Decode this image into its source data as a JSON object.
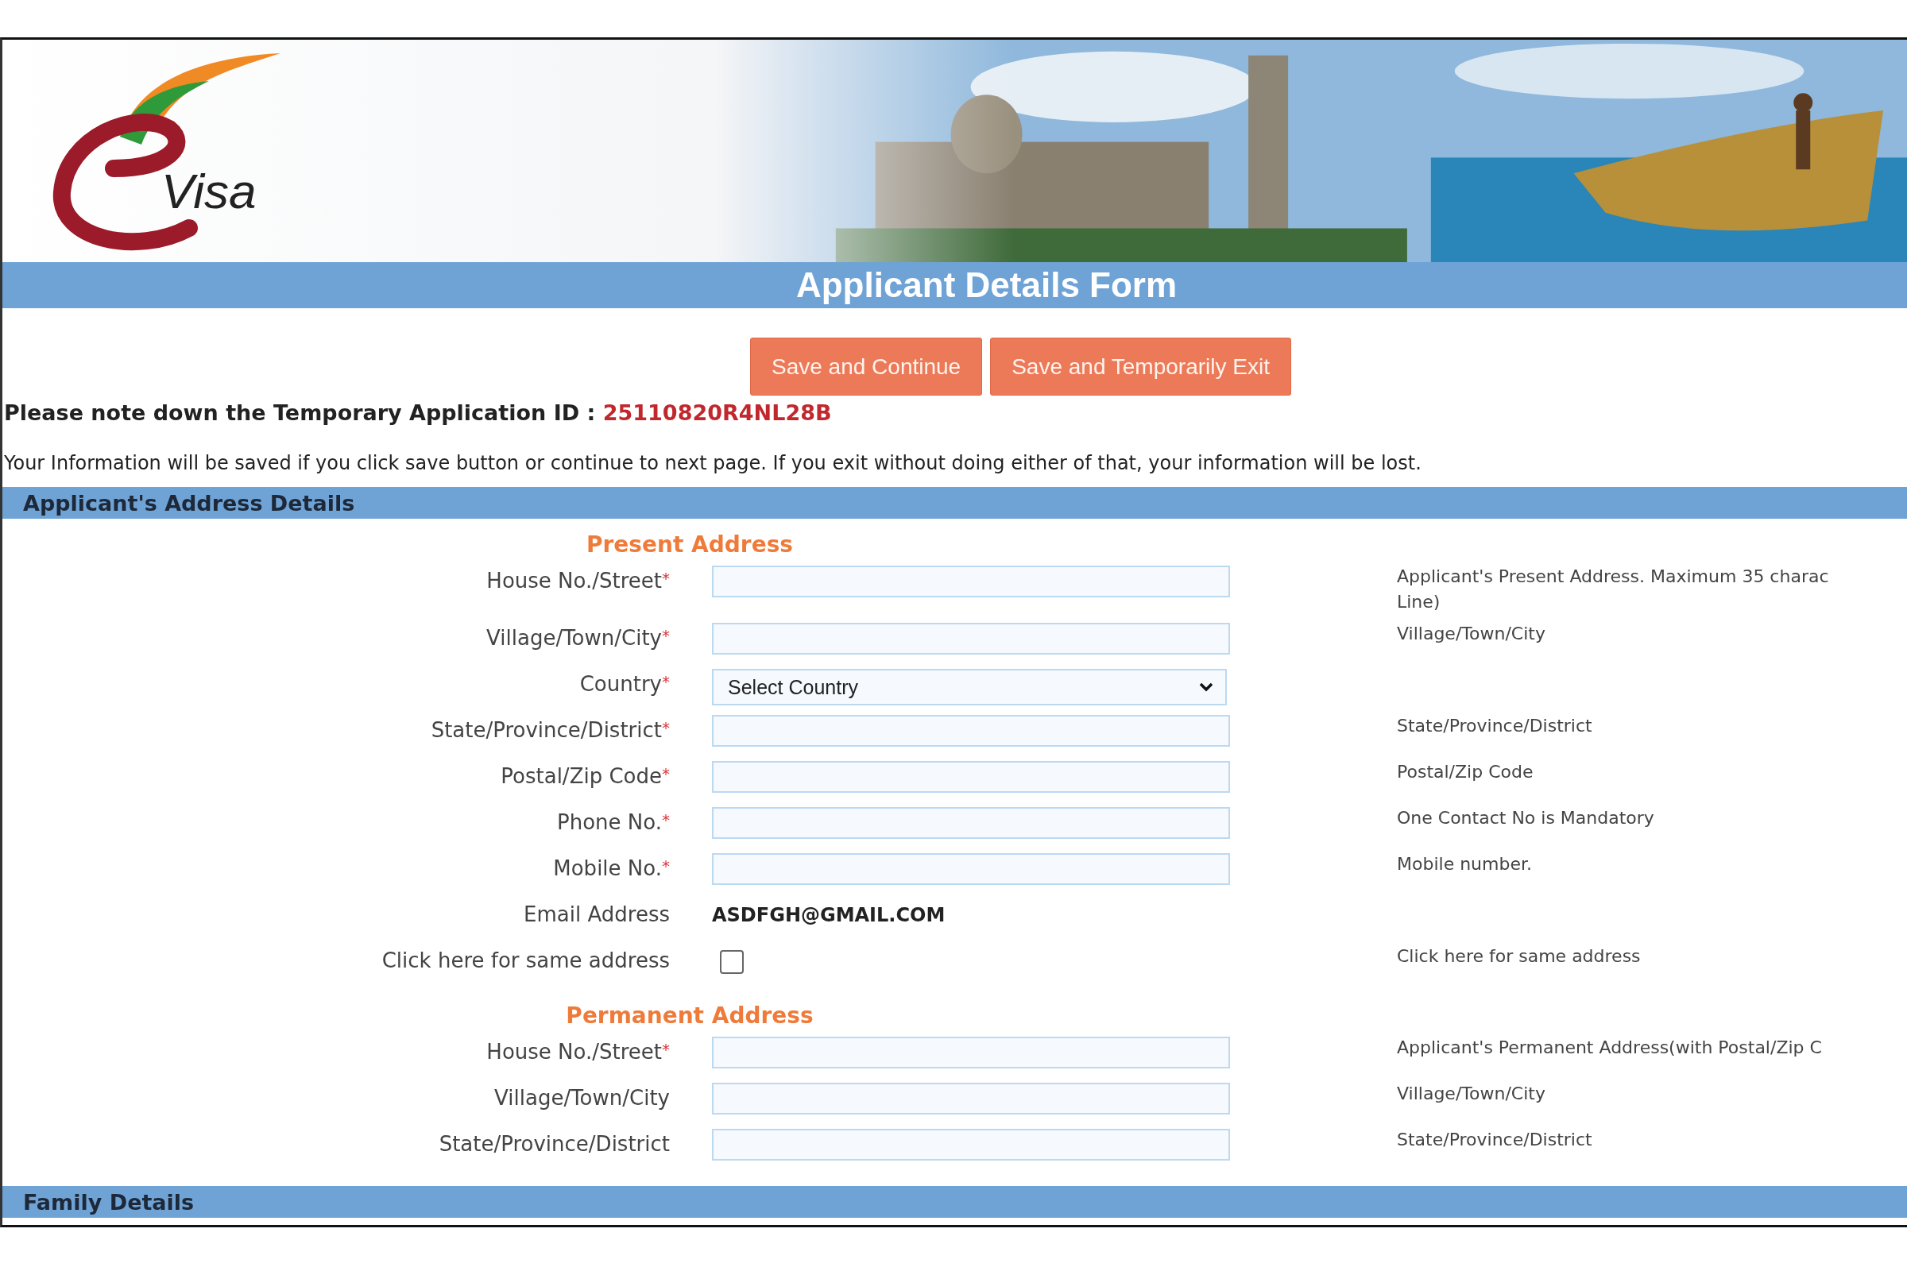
{
  "header": {
    "logo_text": "Visa",
    "title": "Applicant Details Form"
  },
  "buttons": [
    "Save and Continue",
    "Save and Temporarily Exit"
  ],
  "notice": {
    "label": "Please note down the Temporary Application ID :",
    "application_id": "25110820R4NL28B"
  },
  "info": "Your Information will be saved if you click save button or continue to next page. If you exit without doing either of that, your information will be lost.",
  "required_mark": "*",
  "sections": [
    {
      "title": "Applicant's Address Details",
      "groups": [
        {
          "heading": "Present Address",
          "fields": [
            {
              "kind": "text",
              "label": "House No./Street",
              "required": true,
              "hint": [
                "Applicant's Present Address. Maximum 35 charac",
                "Line)"
              ]
            },
            {
              "kind": "text",
              "label": "Village/Town/City",
              "required": true,
              "hint": [
                "Village/Town/City"
              ]
            },
            {
              "kind": "select",
              "label": "Country",
              "required": true,
              "value": "Select Country"
            },
            {
              "kind": "text",
              "label": "State/Province/District",
              "required": true,
              "hint": [
                "State/Province/District"
              ]
            },
            {
              "kind": "text",
              "label": "Postal/Zip Code",
              "required": true,
              "hint": [
                "Postal/Zip Code"
              ]
            },
            {
              "kind": "text",
              "label": "Phone No.",
              "required": true,
              "hint": [
                "One Contact No is Mandatory"
              ]
            },
            {
              "kind": "text",
              "label": "Mobile No.",
              "required": true,
              "hint": [
                "Mobile number."
              ]
            },
            {
              "kind": "static",
              "label": "Email Address",
              "required": false,
              "value": "ASDFGH@GMAIL.COM"
            },
            {
              "kind": "checkbox",
              "label": "Click here for same address",
              "required": false,
              "checked": false,
              "hint": [
                "Click here for same address"
              ]
            }
          ]
        },
        {
          "heading": "Permanent Address",
          "fields": [
            {
              "kind": "text",
              "label": "House No./Street",
              "required": true,
              "hint": [
                "Applicant's Permanent Address(with Postal/Zip C"
              ]
            },
            {
              "kind": "text",
              "label": "Village/Town/City",
              "required": false,
              "hint": [
                "Village/Town/City"
              ]
            },
            {
              "kind": "text",
              "label": "State/Province/District",
              "required": false,
              "hint": [
                "State/Province/District"
              ]
            }
          ]
        }
      ]
    },
    {
      "title": "Family Details"
    }
  ]
}
